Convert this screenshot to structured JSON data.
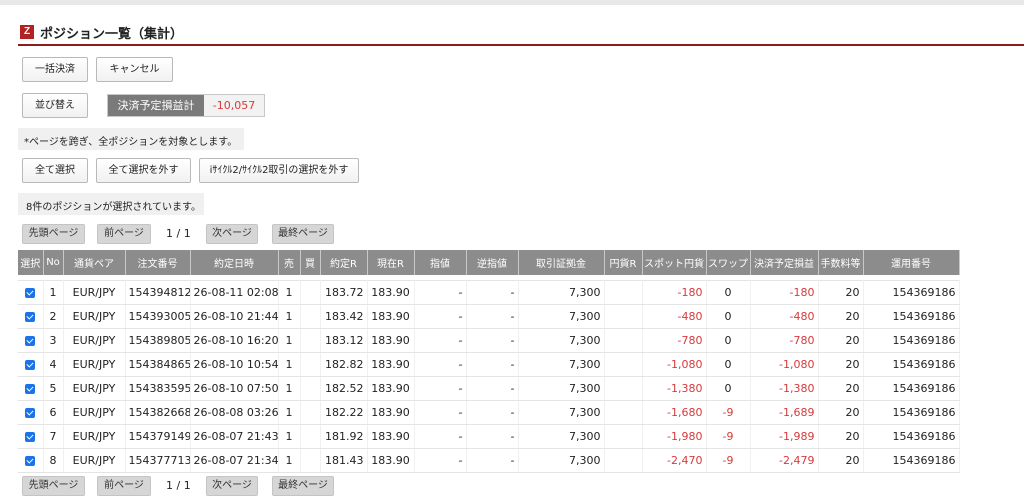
{
  "title": "ポジション一覧（集計）",
  "title_icon": "Z",
  "buttons": {
    "bulk_settle": "一括決済",
    "cancel": "キャンセル",
    "sort": "並び替え",
    "select_all": "全て選択",
    "deselect_all": "全て選択を外す",
    "deselect_cycle": "iｻｲｸﾙ2/ｻｲｸﾙ2取引の選択を外す"
  },
  "summary": {
    "label": "決済予定損益計",
    "value": "-10,057"
  },
  "notes": {
    "cross_page": "*ページを跨ぎ、全ポジションを対象とします。",
    "selected_count": "8件のポジションが選択されています。"
  },
  "pagination": {
    "first": "先頭ページ",
    "prev": "前ページ",
    "page_info": "1 / 1",
    "next": "次ページ",
    "last": "最終ページ"
  },
  "table": {
    "headers": [
      "選択",
      "No",
      "通貨ペア",
      "注文番号",
      "約定日時",
      "売",
      "買",
      "約定R",
      "現在R",
      "指値",
      "逆指値",
      "取引証拠金",
      "円貨R",
      "スポット円貨",
      "スワップ",
      "決済予定損益",
      "手数料等",
      "運用番号"
    ],
    "rows": [
      {
        "no": "1",
        "pair": "EUR/JPY",
        "order": "154394812",
        "datetime": "26-08-11 02:08",
        "sell": "1",
        "buy": "",
        "rate": "183.72",
        "current": "183.90",
        "limit": "-",
        "stop": "-",
        "margin": "7,300",
        "jpy_rate": "",
        "spot": "-180",
        "swap": "0",
        "pnl": "-180",
        "fee": "20",
        "ops": "154369186"
      },
      {
        "no": "2",
        "pair": "EUR/JPY",
        "order": "154393005",
        "datetime": "26-08-10 21:44",
        "sell": "1",
        "buy": "",
        "rate": "183.42",
        "current": "183.90",
        "limit": "-",
        "stop": "-",
        "margin": "7,300",
        "jpy_rate": "",
        "spot": "-480",
        "swap": "0",
        "pnl": "-480",
        "fee": "20",
        "ops": "154369186"
      },
      {
        "no": "3",
        "pair": "EUR/JPY",
        "order": "154389805",
        "datetime": "26-08-10 16:20",
        "sell": "1",
        "buy": "",
        "rate": "183.12",
        "current": "183.90",
        "limit": "-",
        "stop": "-",
        "margin": "7,300",
        "jpy_rate": "",
        "spot": "-780",
        "swap": "0",
        "pnl": "-780",
        "fee": "20",
        "ops": "154369186"
      },
      {
        "no": "4",
        "pair": "EUR/JPY",
        "order": "154384865",
        "datetime": "26-08-10 10:54",
        "sell": "1",
        "buy": "",
        "rate": "182.82",
        "current": "183.90",
        "limit": "-",
        "stop": "-",
        "margin": "7,300",
        "jpy_rate": "",
        "spot": "-1,080",
        "swap": "0",
        "pnl": "-1,080",
        "fee": "20",
        "ops": "154369186"
      },
      {
        "no": "5",
        "pair": "EUR/JPY",
        "order": "154383595",
        "datetime": "26-08-10 07:50",
        "sell": "1",
        "buy": "",
        "rate": "182.52",
        "current": "183.90",
        "limit": "-",
        "stop": "-",
        "margin": "7,300",
        "jpy_rate": "",
        "spot": "-1,380",
        "swap": "0",
        "pnl": "-1,380",
        "fee": "20",
        "ops": "154369186"
      },
      {
        "no": "6",
        "pair": "EUR/JPY",
        "order": "154382668",
        "datetime": "26-08-08 03:26",
        "sell": "1",
        "buy": "",
        "rate": "182.22",
        "current": "183.90",
        "limit": "-",
        "stop": "-",
        "margin": "7,300",
        "jpy_rate": "",
        "spot": "-1,680",
        "swap": "-9",
        "pnl": "-1,689",
        "fee": "20",
        "ops": "154369186"
      },
      {
        "no": "7",
        "pair": "EUR/JPY",
        "order": "154379149",
        "datetime": "26-08-07 21:43",
        "sell": "1",
        "buy": "",
        "rate": "181.92",
        "current": "183.90",
        "limit": "-",
        "stop": "-",
        "margin": "7,300",
        "jpy_rate": "",
        "spot": "-1,980",
        "swap": "-9",
        "pnl": "-1,989",
        "fee": "20",
        "ops": "154369186"
      },
      {
        "no": "8",
        "pair": "EUR/JPY",
        "order": "154377713",
        "datetime": "26-08-07 21:34",
        "sell": "1",
        "buy": "",
        "rate": "181.43",
        "current": "183.90",
        "limit": "-",
        "stop": "-",
        "margin": "7,300",
        "jpy_rate": "",
        "spot": "-2,470",
        "swap": "-9",
        "pnl": "-2,479",
        "fee": "20",
        "ops": "154369186"
      }
    ]
  },
  "colors": {
    "accent": "#8e1a1a",
    "negative": "#d83a3a",
    "header_bg": "#8c8c8c",
    "checkbox": "#1a73e8"
  }
}
